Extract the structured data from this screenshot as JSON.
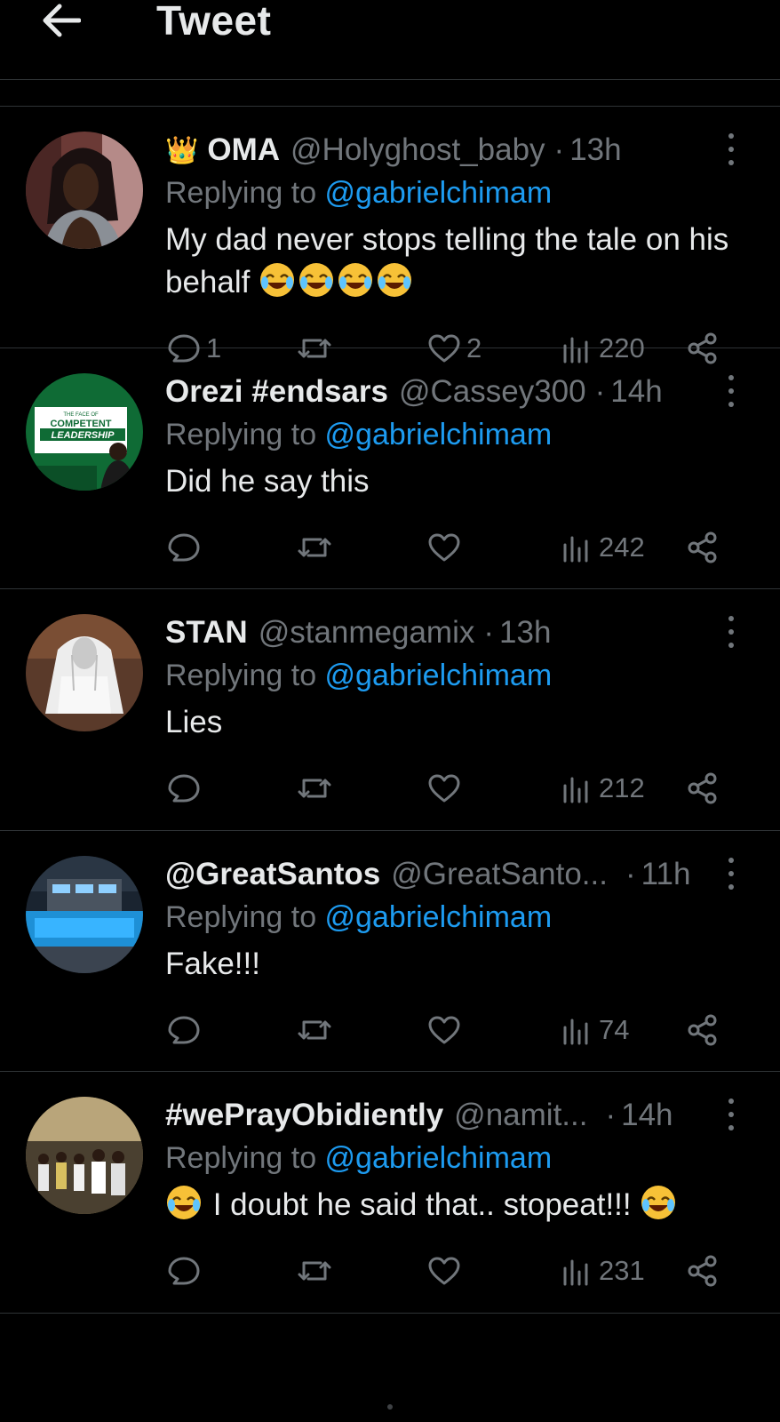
{
  "header": {
    "title": "Tweet",
    "back_icon": "arrow-left-icon"
  },
  "colors": {
    "background": "#000000",
    "text": "#e7e9ea",
    "muted": "#71767b",
    "accent": "#1d9bf0",
    "divider": "#2f3336"
  },
  "replies": [
    {
      "display_name": "OMA",
      "has_crown": true,
      "crown": "👑",
      "handle": "@Holyghost_baby",
      "separator": "·",
      "time": "13h",
      "replying_prefix": "Replying to ",
      "replying_to": "@gabrielchimam",
      "text": "My dad never stops telling the tale on his behalf",
      "trailing_emoji_count": 4,
      "reply_count": "1",
      "retweet_count": "",
      "like_count": "2",
      "view_count": "220"
    },
    {
      "display_name": "Orezi #endsars",
      "handle": "@Cassey300",
      "separator": "·",
      "time": "14h",
      "replying_prefix": "Replying to ",
      "replying_to": "@gabrielchimam",
      "text": "Did he say this",
      "reply_count": "",
      "retweet_count": "",
      "like_count": "",
      "view_count": "242",
      "avatar_text": [
        "THE FACE OF",
        "COMPETENT",
        "LEADERSHIP"
      ]
    },
    {
      "display_name": "STAN",
      "handle": "@stanmegamix",
      "separator": "·",
      "time": "13h",
      "replying_prefix": "Replying to ",
      "replying_to": "@gabrielchimam",
      "text": "Lies",
      "reply_count": "",
      "retweet_count": "",
      "like_count": "",
      "view_count": "212"
    },
    {
      "display_name": "@GreatSantos",
      "handle": "@GreatSanto...",
      "separator": "·",
      "time": "11h",
      "replying_prefix": "Replying to ",
      "replying_to": "@gabrielchimam",
      "text": "Fake!!!",
      "reply_count": "",
      "retweet_count": "",
      "like_count": "",
      "view_count": "74"
    },
    {
      "display_name": "#wePrayObidiently",
      "handle": "@namit...",
      "separator": "·",
      "time": "14h",
      "replying_prefix": "Replying to ",
      "replying_to": "@gabrielchimam",
      "text": "I doubt he said that.. stopeat!!!",
      "leading_emoji": true,
      "trailing_emoji_count": 1,
      "reply_count": "",
      "retweet_count": "",
      "like_count": "",
      "view_count": "231"
    }
  ],
  "icons": {
    "reply": "reply-icon",
    "retweet": "retweet-icon",
    "like": "heart-icon",
    "views": "views-icon",
    "share": "share-icon",
    "more": "more-icon"
  }
}
